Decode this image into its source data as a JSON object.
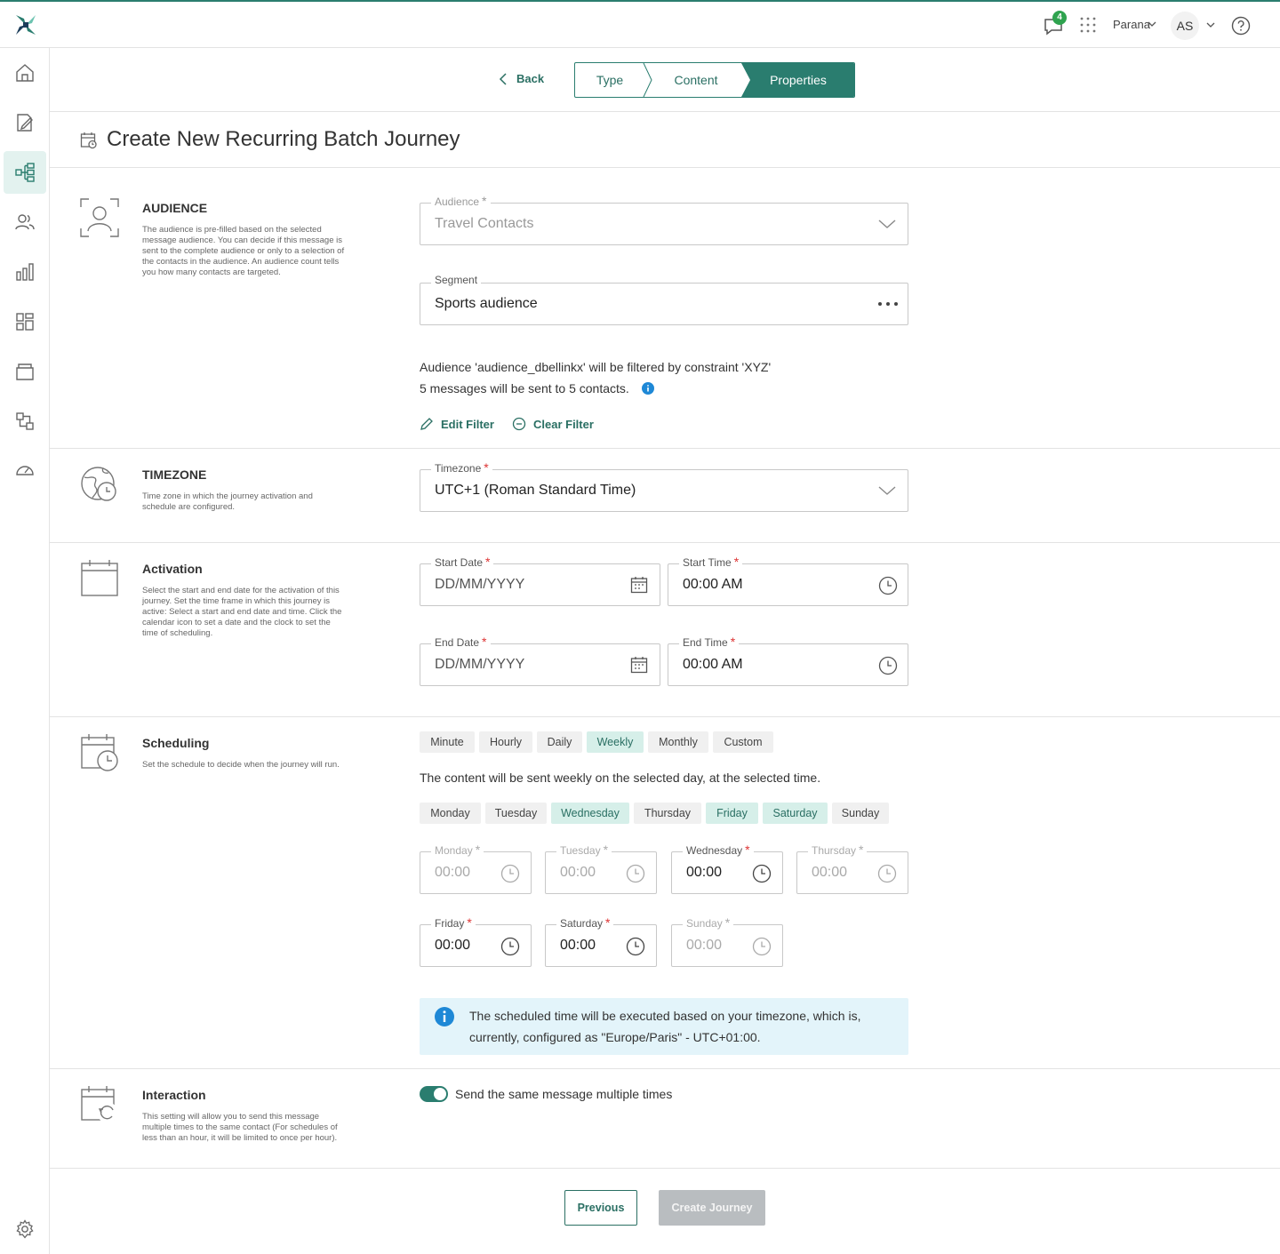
{
  "topbar": {
    "notifications_count": "4",
    "org_name": "Parana",
    "user_initials": "AS"
  },
  "sidebar": {
    "items": [
      {
        "icon": "home-icon"
      },
      {
        "icon": "edit-document-icon"
      },
      {
        "icon": "journey-icon",
        "active": true
      },
      {
        "icon": "contacts-icon"
      },
      {
        "icon": "analytics-icon"
      },
      {
        "icon": "dashboard-icon"
      },
      {
        "icon": "box-icon"
      },
      {
        "icon": "integrations-icon"
      },
      {
        "icon": "speedometer-icon"
      },
      {
        "icon": "settings-icon"
      }
    ]
  },
  "stepper": {
    "back_label": "Back",
    "steps": [
      "Type",
      "Content",
      "Properties"
    ],
    "active_step": "Properties"
  },
  "page": {
    "title": "Create New Recurring Batch Journey"
  },
  "audience": {
    "title": "AUDIENCE",
    "description": "The audience is pre-filled based on the selected message audience. You can decide if this message is sent to the complete audience or only to a selection of the contacts in the audience. An audience count tells you how many contacts are targeted.",
    "audience_label": "Audience",
    "audience_value": "Travel Contacts",
    "segment_label": "Segment",
    "segment_value": "Sports audience",
    "filter_text": "Audience 'audience_dbellinkx' will be filtered by constraint 'XYZ'",
    "count_text": "5 messages will be sent to 5 contacts.",
    "edit_filter": "Edit Filter",
    "clear_filter": "Clear Filter"
  },
  "timezone": {
    "title": "TIMEZONE",
    "description": "Time zone in which the journey activation and schedule are configured.",
    "label": "Timezone",
    "value": "UTC+1 (Roman Standard Time)"
  },
  "activation": {
    "title": "Activation",
    "description": "Select the start and end date for the activation of this journey. Set the time frame in which this journey is active: Select a start and end date and time. Click the calendar icon to set a date and the clock to set the time of scheduling.",
    "start_date_label": "Start Date",
    "start_date_placeholder": "DD/MM/YYYY",
    "start_time_label": "Start Time",
    "start_time_value": "00:00 AM",
    "end_date_label": "End Date",
    "end_date_placeholder": "DD/MM/YYYY",
    "end_time_label": "End Time",
    "end_time_value": "00:00 AM"
  },
  "scheduling": {
    "title": "Scheduling",
    "description": "Set the schedule to decide when the journey will run.",
    "frequencies": [
      "Minute",
      "Hourly",
      "Daily",
      "Weekly",
      "Monthly",
      "Custom"
    ],
    "selected_frequency": "Weekly",
    "summary": "The content will be sent weekly on the selected day, at the selected time.",
    "days": [
      "Monday",
      "Tuesday",
      "Wednesday",
      "Thursday",
      "Friday",
      "Saturday",
      "Sunday"
    ],
    "selected_days": [
      "Wednesday",
      "Friday",
      "Saturday"
    ],
    "day_times": [
      {
        "label": "Monday",
        "value": "00:00",
        "enabled": false
      },
      {
        "label": "Tuesday",
        "value": "00:00",
        "enabled": false
      },
      {
        "label": "Wednesday",
        "value": "00:00",
        "enabled": true
      },
      {
        "label": "Thursday",
        "value": "00:00",
        "enabled": false
      },
      {
        "label": "Friday",
        "value": "00:00",
        "enabled": true
      },
      {
        "label": "Saturday",
        "value": "00:00",
        "enabled": true
      },
      {
        "label": "Sunday",
        "value": "00:00",
        "enabled": false
      }
    ],
    "info_text": "The scheduled time will be executed based on your timezone, which is, currently, configured as \"Europe/Paris\" - UTC+01:00."
  },
  "interaction": {
    "title": "Interaction",
    "description": "This setting will allow you to send this message multiple times to the same contact (For schedules of less than an hour, it will be limited to once per hour).",
    "toggle_label": "Send the same message multiple times",
    "toggle_on": true
  },
  "footer": {
    "previous_label": "Previous",
    "create_label": "Create Journey"
  },
  "colors": {
    "brand": "#2a7d6f",
    "selected_pill": "#d6efe9",
    "info_bg": "#e3f4fa",
    "disabled_button": "#b9bdc0"
  }
}
